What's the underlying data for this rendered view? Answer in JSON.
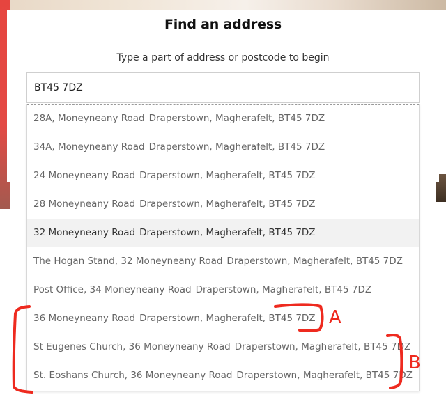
{
  "dialog": {
    "title": "Find an address",
    "subtitle": "Type a part of address or postcode to begin"
  },
  "search": {
    "value": "BT45 7DZ"
  },
  "results": [
    {
      "line1": "28A, Moneyneany Road",
      "line2": "Draperstown, Magherafelt, BT45 7DZ"
    },
    {
      "line1": "34A, Moneyneany Road",
      "line2": "Draperstown, Magherafelt, BT45 7DZ"
    },
    {
      "line1": "24 Moneyneany Road",
      "line2": "Draperstown, Magherafelt, BT45 7DZ"
    },
    {
      "line1": "28 Moneyneany Road",
      "line2": "Draperstown, Magherafelt, BT45 7DZ"
    },
    {
      "line1": "32 Moneyneany Road",
      "line2": "Draperstown, Magherafelt, BT45 7DZ"
    },
    {
      "line1": "The Hogan Stand, 32 Moneyneany Road",
      "line2": "Draperstown, Magherafelt, BT45 7DZ"
    },
    {
      "line1": "Post Office, 34 Moneyneany Road",
      "line2": "Draperstown, Magherafelt, BT45 7DZ"
    },
    {
      "line1": "36 Moneyneany Road",
      "line2": "Draperstown, Magherafelt, BT45 7DZ"
    },
    {
      "line1": "St Eugenes Church, 36 Moneyneany Road",
      "line2": "Draperstown, Magherafelt, BT45 7DZ"
    },
    {
      "line1": "St. Eoshans Church, 36 Moneyneany Road",
      "line2": "Draperstown, Magherafelt, BT45 7DZ"
    }
  ],
  "annotations": {
    "label_a": "A",
    "label_b": "B",
    "color": "#ee2a1f"
  }
}
